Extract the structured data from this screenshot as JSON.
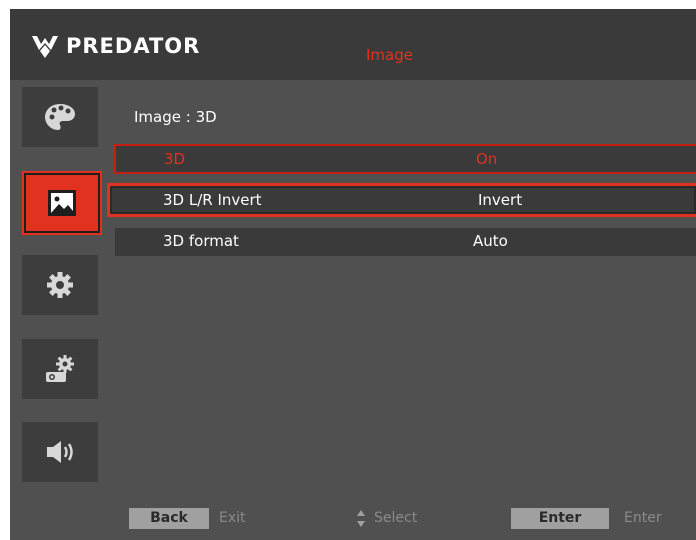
{
  "header": {
    "brand": "PREDATOR",
    "title": "Image"
  },
  "sidebar": {
    "items": [
      {
        "name": "color",
        "icon": "palette-icon"
      },
      {
        "name": "image",
        "icon": "picture-icon",
        "active": true
      },
      {
        "name": "settings",
        "icon": "gear-icon"
      },
      {
        "name": "system",
        "icon": "projector-gear-icon"
      },
      {
        "name": "audio",
        "icon": "speaker-icon"
      }
    ]
  },
  "breadcrumb": "Image : 3D",
  "menu": {
    "rows": [
      {
        "label": "3D",
        "value": "On"
      },
      {
        "label": "3D L/R Invert",
        "value": "Invert"
      },
      {
        "label": "3D format",
        "value": "Auto"
      }
    ]
  },
  "footer": {
    "back_key": "Back",
    "back_text": "Exit",
    "select_text": "Select",
    "enter_key": "Enter",
    "enter_text": "Enter"
  },
  "colors": {
    "accent": "#e0321e",
    "panel": "#505050",
    "row": "#3a3a3a"
  }
}
